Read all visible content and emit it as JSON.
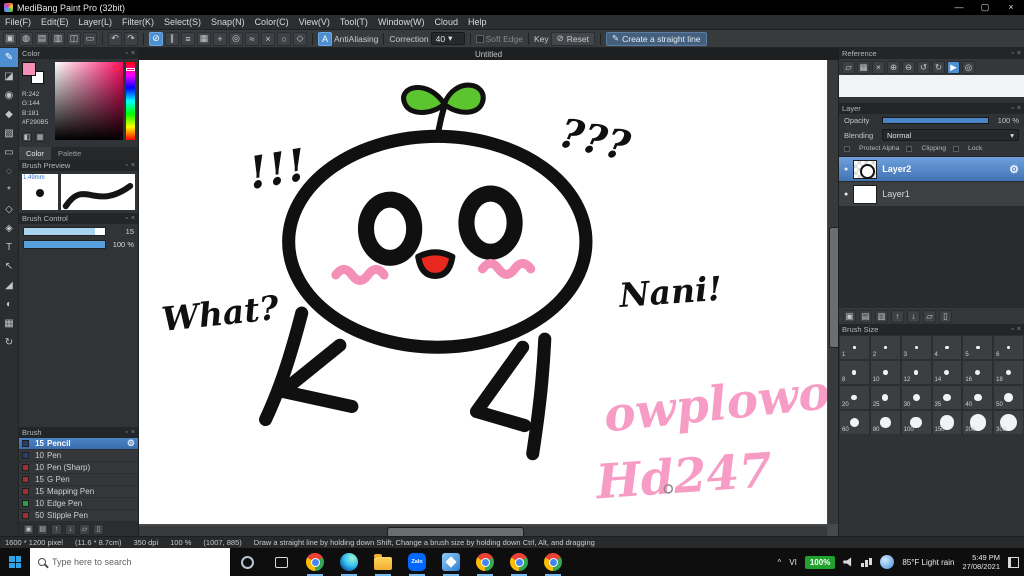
{
  "window": {
    "title": "MediBang Paint Pro (32bit)"
  },
  "icons": {
    "app_minimize": "—",
    "app_maximize": "▢",
    "app_close": "×",
    "undo": "↶",
    "redo": "↷",
    "dropdown_arrow": "▾",
    "reset": "⊘",
    "pen": "✎",
    "panel_float": "▫",
    "panel_close": "×",
    "gear": "⚙",
    "visible_dot": "●",
    "chevron_up": "^"
  },
  "menubar": {
    "items": [
      "File(F)",
      "Edit(E)",
      "Layer(L)",
      "Filter(K)",
      "Select(S)",
      "Snap(N)",
      "Color(C)",
      "View(V)",
      "Tool(T)",
      "Window(W)",
      "Cloud",
      "Help"
    ]
  },
  "toolbar": {
    "group_icons": [
      "▣",
      "◍",
      "▤",
      "▥",
      "◫",
      "▭"
    ],
    "snap_icons": [
      "⊘",
      "∥",
      "≡",
      "▦",
      "+",
      "◎",
      "≈",
      "×",
      "○",
      "◇"
    ],
    "antialiasing": "AntiAliasing",
    "correction_label": "Correction",
    "correction_value": "40",
    "soft_edge": "Soft Edge",
    "key_label": "Key",
    "reset": "Reset",
    "straight_line": "Create a straight line"
  },
  "toolstrip": [
    "✎",
    "◪",
    "◉",
    "◆",
    "▨",
    "▭",
    "◌",
    "*",
    "◇",
    "◈",
    "T",
    "↖",
    "◢",
    "◐",
    "▦",
    "↻"
  ],
  "color_panel": {
    "title": "Color",
    "r": "R:242",
    "g": "G:144",
    "b": "B:181",
    "hex": "#F290B5",
    "fg_color": "#F290B5",
    "tabs": [
      "Color",
      "Palette"
    ]
  },
  "brush_preview": {
    "title": "Brush Preview",
    "size": "1.49mm"
  },
  "brush_control": {
    "title": "Brush Control",
    "value1": "15",
    "value2": "100 %"
  },
  "brush_panel": {
    "title": "Brush",
    "items": [
      {
        "size": "15",
        "name": "Pencil",
        "color": "#263f6e",
        "selected": true
      },
      {
        "size": "10",
        "name": "Pen",
        "color": "#263f6e",
        "selected": false
      },
      {
        "size": "10",
        "name": "Pen (Sharp)",
        "color": "#a03030",
        "selected": false
      },
      {
        "size": "15",
        "name": "G Pen",
        "color": "#a03030",
        "selected": false
      },
      {
        "size": "15",
        "name": "Mapping Pen",
        "color": "#a03030",
        "selected": false
      },
      {
        "size": "10",
        "name": "Edge Pen",
        "color": "#2f9a4a",
        "selected": false
      },
      {
        "size": "50",
        "name": "Stipple Pen",
        "color": "#a03030",
        "selected": false
      }
    ]
  },
  "canvas": {
    "tab": "Untitled",
    "annotations": {
      "exclaim": "!!!",
      "question": "???",
      "what": "What?",
      "nani": "Nani!",
      "pink1": "owplowo",
      "pink2": "Hd247"
    }
  },
  "reference_panel": {
    "title": "Reference",
    "icons": [
      "▱",
      "▦",
      "×",
      "⊕",
      "⊖",
      "↺",
      "↻",
      "▶",
      "◎"
    ]
  },
  "layer_panel": {
    "title": "Layer",
    "opacity_label": "Opacity",
    "opacity_value": "100 %",
    "blending_label": "Blending",
    "blending_value": "Normal",
    "protect_alpha": "Protect Alpha",
    "clipping": "Clipping",
    "lock": "Lock",
    "layers": [
      {
        "name": "Layer2",
        "selected": true
      },
      {
        "name": "Layer1",
        "selected": false
      }
    ],
    "tool_icons": [
      "▣",
      "▤",
      "▥",
      "↑",
      "↓",
      "▱",
      "▯"
    ]
  },
  "brush_size_panel": {
    "title": "Brush Size",
    "sizes": [
      1,
      2,
      3,
      4,
      5,
      6,
      8,
      10,
      12,
      14,
      16,
      18,
      20,
      25,
      30,
      35,
      40,
      50,
      60,
      80,
      100,
      150,
      200,
      300
    ]
  },
  "brush_dock_icons": [
    "▣",
    "▤",
    "↑",
    "↓",
    "▱",
    "▯"
  ],
  "statusbar": {
    "size": "1600 * 1200 pixel",
    "dimensions": "(11.6 * 8.7cm)",
    "dpi": "350 dpi",
    "zoom": "100 %",
    "coords": "(1007, 885)",
    "tip": "Draw a straight line by holding down Shift, Change a brush size by holding down Ctrl, Alt, and dragging"
  },
  "taskbar": {
    "search_placeholder": "Type here to search",
    "zalo_label": "Zalo",
    "language": "VI",
    "battery": "100%",
    "weather": "85°F Light rain",
    "time": "5:49 PM",
    "date": "27/08/2021"
  }
}
